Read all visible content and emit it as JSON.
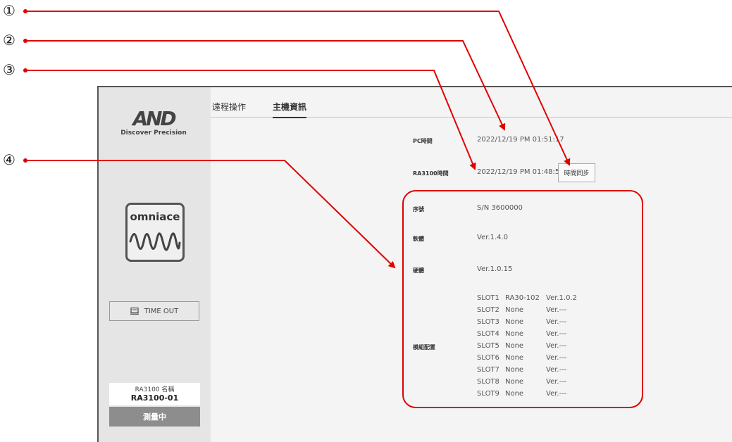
{
  "callouts": [
    "①",
    "②",
    "③",
    "④"
  ],
  "brand": {
    "logo_text": "AND",
    "tagline": "Discover Precision"
  },
  "app_icon": {
    "name": "omniace"
  },
  "sidebar": {
    "timeout_label": "TIME OUT",
    "device_name_label": "RA3100 名稱",
    "device_name_value": "RA3100-01",
    "status_label": "測量中"
  },
  "tabs": [
    {
      "label": "遠程操作",
      "active": false
    },
    {
      "label": "主機資訊",
      "active": true
    }
  ],
  "info": {
    "pc_time_label": "PC時間",
    "pc_time_value": "2022/12/19 PM 01:51:17",
    "device_time_label": "RA3100時間",
    "device_time_value": "2022/12/19 PM 01:48:57",
    "sync_button_label": "時間同步",
    "serial_label": "序號",
    "serial_value": "S/N 3600000",
    "software_label": "軟體",
    "software_value": "Ver.1.4.0",
    "hardware_label": "硬體",
    "hardware_value": "Ver.1.0.15",
    "module_label": "模組配置"
  },
  "slots": [
    {
      "slot": "SLOT1",
      "module": "RA30-102",
      "version": "Ver.1.0.2"
    },
    {
      "slot": "SLOT2",
      "module": "None",
      "version": "Ver.---"
    },
    {
      "slot": "SLOT3",
      "module": "None",
      "version": "Ver.---"
    },
    {
      "slot": "SLOT4",
      "module": "None",
      "version": "Ver.---"
    },
    {
      "slot": "SLOT5",
      "module": "None",
      "version": "Ver.---"
    },
    {
      "slot": "SLOT6",
      "module": "None",
      "version": "Ver.---"
    },
    {
      "slot": "SLOT7",
      "module": "None",
      "version": "Ver.---"
    },
    {
      "slot": "SLOT8",
      "module": "None",
      "version": "Ver.---"
    },
    {
      "slot": "SLOT9",
      "module": "None",
      "version": "Ver.---"
    }
  ],
  "colors": {
    "annotation": "#e00000",
    "sidebar": "#e5e5e5",
    "status_bg": "#8d8d8d"
  }
}
